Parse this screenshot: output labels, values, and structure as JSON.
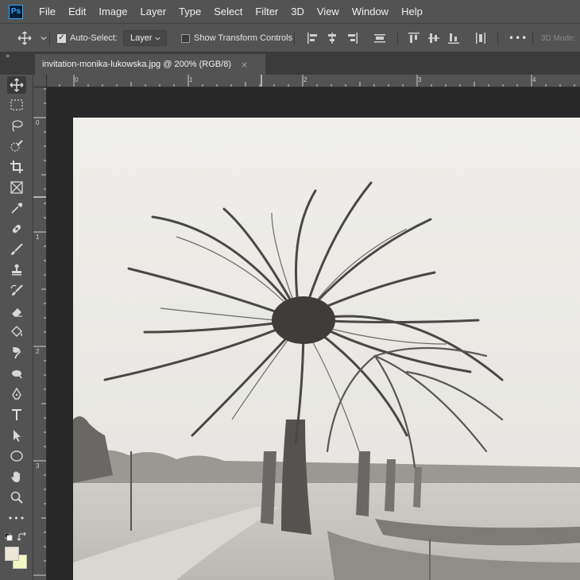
{
  "app": {
    "logo_text": "Ps"
  },
  "menu": [
    "File",
    "Edit",
    "Image",
    "Layer",
    "Type",
    "Select",
    "Filter",
    "3D",
    "View",
    "Window",
    "Help"
  ],
  "options": {
    "auto_select_label": "Auto-Select:",
    "auto_select_checked": true,
    "auto_select_target": "Layer",
    "show_transform_label": "Show Transform Controls",
    "show_transform_checked": false,
    "more_label": "•••",
    "mode_3d_label": "3D Mode:"
  },
  "document": {
    "tab_title": "invitation-monika-lukowska.jpg @ 200% (RGB/8)",
    "close_glyph": "×",
    "collapse_glyph": "»"
  },
  "rulers": {
    "top_numbers": [
      "0",
      "1",
      "2",
      "3",
      "4"
    ],
    "left_numbers": [
      "0",
      "1",
      "2",
      "3"
    ]
  },
  "tools": [
    "move-tool",
    "marquee-tool",
    "lasso-tool",
    "quick-select-tool",
    "crop-tool",
    "frame-tool",
    "eyedropper-tool",
    "healing-tool",
    "brush-tool",
    "stamp-tool",
    "history-brush-tool",
    "eraser-tool",
    "paint-bucket-tool",
    "blur-tool",
    "dodge-tool",
    "pen-tool",
    "type-tool",
    "path-select-tool",
    "shape-tool",
    "hand-tool",
    "zoom-tool",
    "more-tools"
  ],
  "toolbar_more_label": "•••",
  "colors": {
    "foreground": "#ece6d8",
    "background": "#f3f7c4",
    "accent": "#31a8ff"
  }
}
